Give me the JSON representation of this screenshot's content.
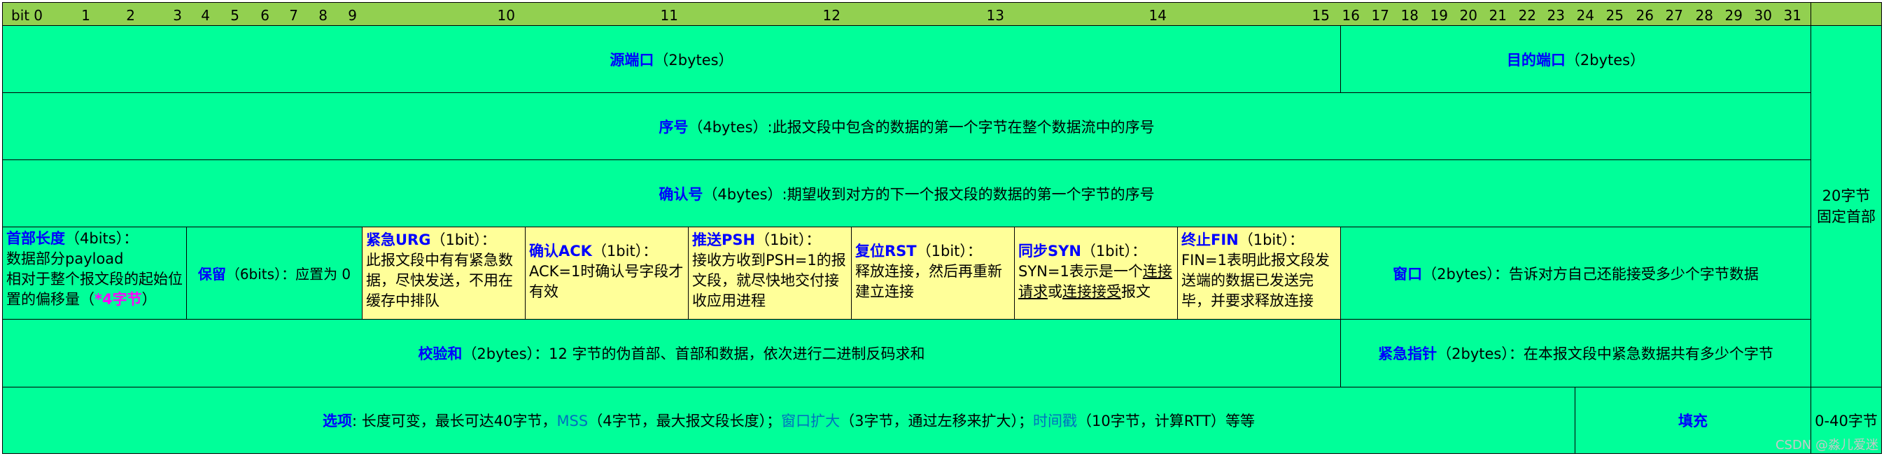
{
  "bit_header": {
    "label": "bit",
    "numbers": [
      "0",
      "1",
      "2",
      "3",
      "4",
      "5",
      "6",
      "7",
      "8",
      "9",
      "10",
      "11",
      "12",
      "13",
      "14",
      "15",
      "16",
      "17",
      "18",
      "19",
      "20",
      "21",
      "22",
      "23",
      "24",
      "25",
      "26",
      "27",
      "28",
      "29",
      "30",
      "31"
    ]
  },
  "row1": {
    "src_port": {
      "name": "源端口",
      "detail": "（2bytes）"
    },
    "dst_port": {
      "name": "目的端口",
      "detail": "（2bytes）"
    }
  },
  "row2": {
    "name": "序号",
    "detail": "（4bytes）:此报文段中包含的数据的第一个字节在整个数据流中的序号"
  },
  "row3": {
    "name": "确认号",
    "detail": "（4bytes）:期望收到对方的下一个报文段的数据的第一个字节的序号"
  },
  "row4": {
    "header_length": {
      "name": "首部长度",
      "detail": "（4bits）：",
      "line2": "数据部分payload",
      "line3": "相对于整个报文段的起始位",
      "line4a": "置的偏移量（",
      "line4b": "*4字节",
      "line4c": "）"
    },
    "reserved": {
      "name": "保留",
      "detail": "（6bits）：应置为 0"
    },
    "urg": {
      "name": "紧急URG",
      "detail": "（1bit）：",
      "line2": "此报文段中有有紧急数",
      "line3": "据，尽快发送，不用在",
      "line4": "缓存中排队"
    },
    "ack": {
      "name": "确认ACK",
      "detail": "（1bit）：",
      "line2": "ACK=1时确认号字段才",
      "line3": "有效"
    },
    "psh": {
      "name": "推送PSH",
      "detail": "（1bit）：",
      "line2": "接收方收到PSH=1的报",
      "line3": "文段，就尽快地交付接",
      "line4": "收应用进程"
    },
    "rst": {
      "name": "复位RST",
      "detail": "（1bit）：",
      "line2": "释放连接，然后再重新",
      "line3": "建立连接"
    },
    "syn": {
      "name": "同步SYN",
      "detail": "（1bit）：",
      "line2a": "SYN=1表示是一个",
      "line2b": "连接",
      "line3a": "请求",
      "line3b": "或",
      "line3c": "连接接受",
      "line3d": "报文"
    },
    "fin": {
      "name": "终止FIN",
      "detail": "（1bit）：",
      "line2": "FIN=1表明此报文段发",
      "line3": "送端的数据已发送完",
      "line4": "毕，并要求释放连接"
    },
    "window": {
      "name": "窗口",
      "detail": "（2bytes）：告诉对方自己还能接受多少个字节数据"
    }
  },
  "row5": {
    "checksum": {
      "name": "校验和",
      "detail": "（2bytes）：12 字节的伪首部、首部和数据，依次进行二进制反码求和"
    },
    "urgent_pointer": {
      "name": "紧急指针",
      "detail": "（2bytes）：在本报文段中紧急数据共有多少个字节"
    }
  },
  "row6": {
    "options": {
      "name": "选项",
      "p1": ":  长度可变，最长可达40字节，",
      "mss": "MSS",
      "p2": "（4字节，最大报文段长度）；",
      "wscale": "窗口扩大",
      "p3": "（3字节，通过左移来扩大）；",
      "timestamp": "时间戳",
      "p4": "（10字节，计算RTT）等等"
    },
    "padding": {
      "name": "填充"
    }
  },
  "side": {
    "fixed_line1": "20字节",
    "fixed_line2": "固定首部",
    "options_size": "0-40字节"
  },
  "watermark": "CSDN @淼儿爱迷"
}
